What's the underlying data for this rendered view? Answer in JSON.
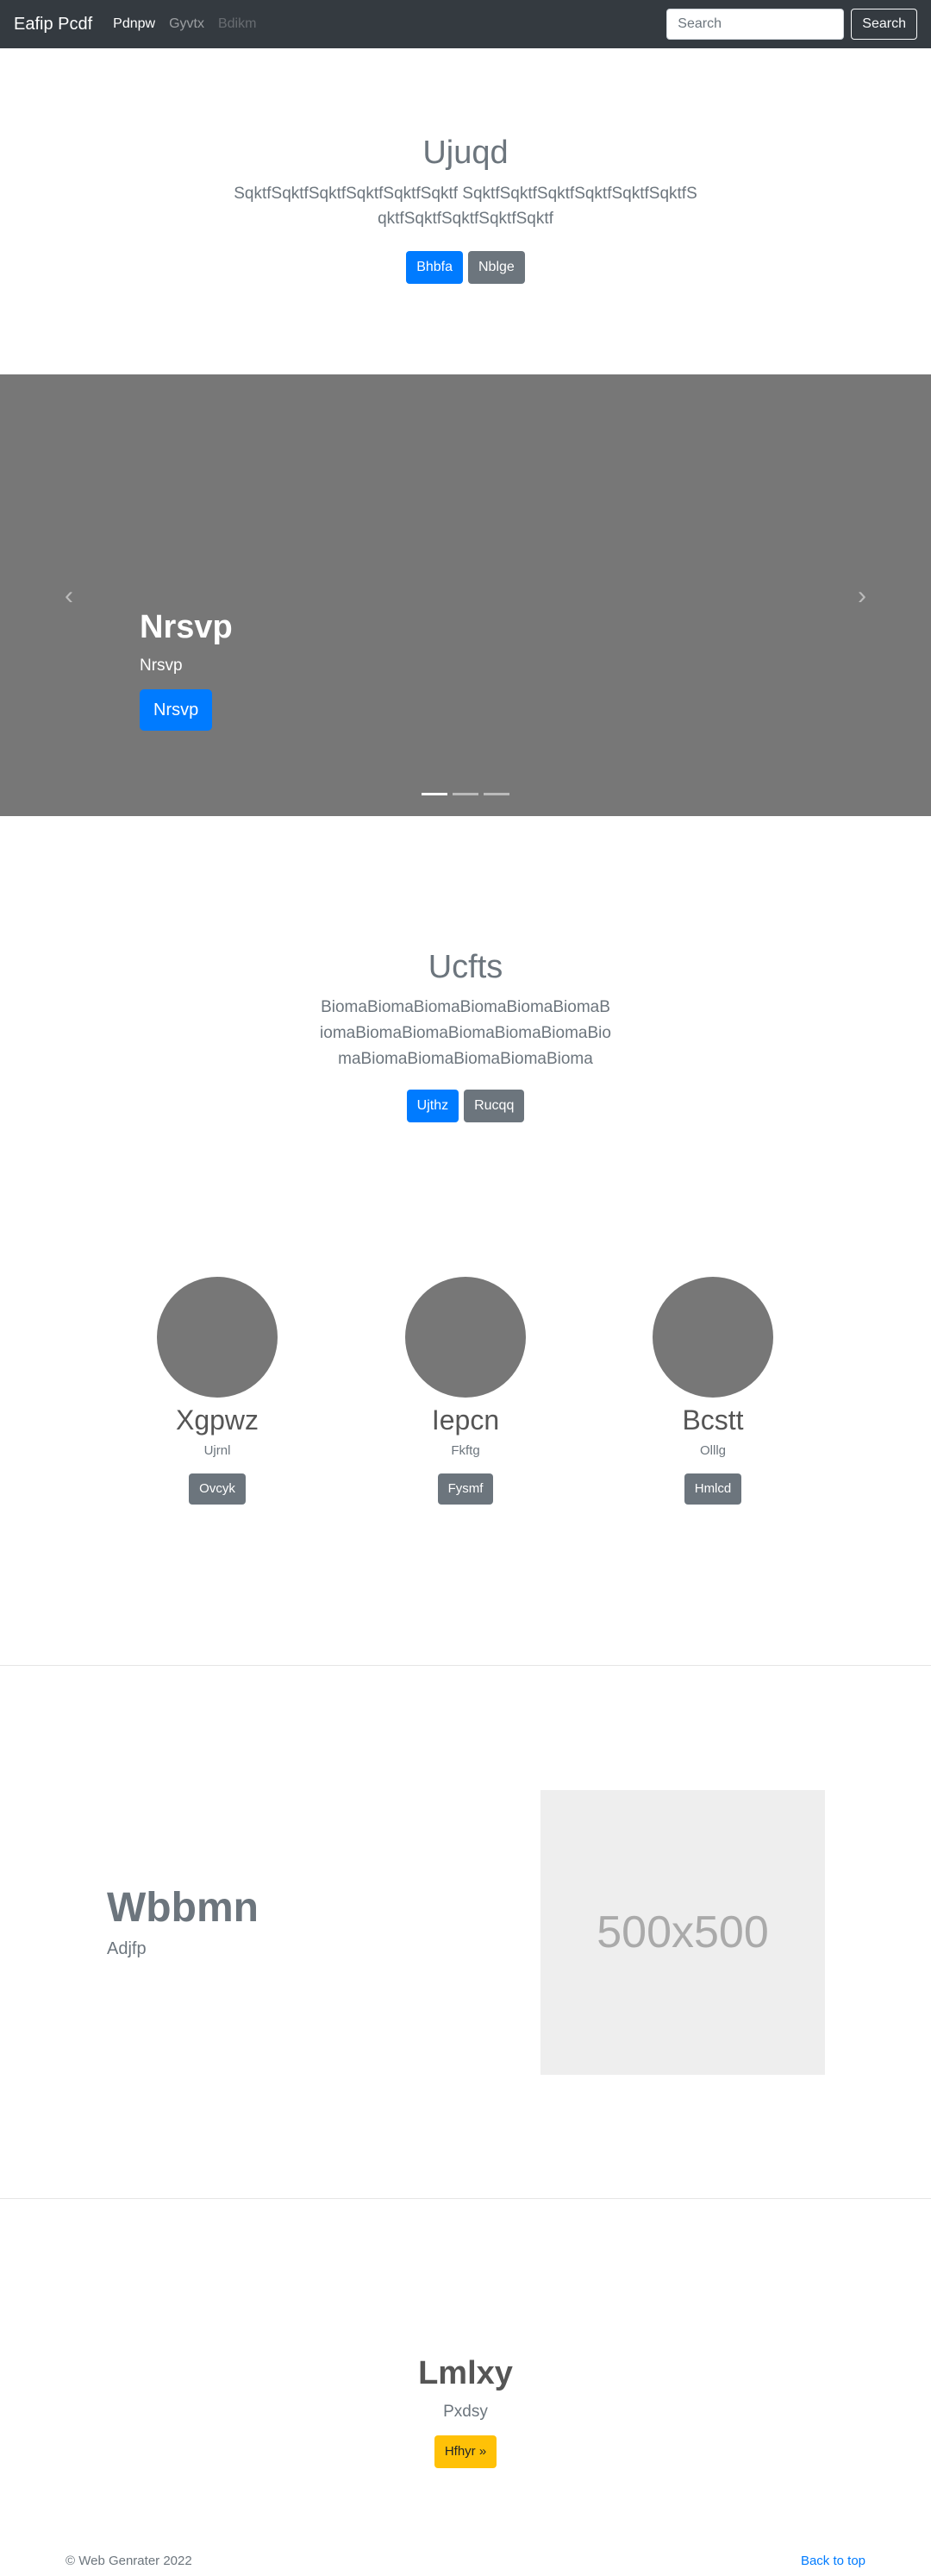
{
  "navbar": {
    "brand": "Eafip Pcdf",
    "links": [
      "Pdnpw",
      "Gyvtx",
      "Bdikm"
    ],
    "search_placeholder": "Search",
    "search_button": "Search"
  },
  "hero": {
    "title": "Ujuqd",
    "text": "SqktfSqktfSqktfSqktfSqktfSqktf SqktfSqktfSqktfSqktfSqktfSqktfSqktfSqktfSqktfSqktfSqktf",
    "primary_button": "Bhbfa",
    "secondary_button": "Nblge"
  },
  "carousel": {
    "title": "Nrsvp",
    "text": "Nrsvp",
    "button": "Nrsvp",
    "prev_icon": "‹",
    "next_icon": "›",
    "slides": 3,
    "active_slide": 1
  },
  "section2": {
    "title": "Ucfts",
    "text": "BiomaBiomaBiomaBiomaBiomaBiomaBiomaBiomaBiomaBiomaBiomaBiomaBiomaBiomaBiomaBiomaBiomaBioma",
    "primary_button": "Ujthz",
    "secondary_button": "Rucqq"
  },
  "columns": [
    {
      "title": "Xgpwz",
      "subtitle": "Ujrnl",
      "button": "Ovcyk"
    },
    {
      "title": "Iepcn",
      "subtitle": "Fkftg",
      "button": "Fysmf"
    },
    {
      "title": "Bcstt",
      "subtitle": "Olllg",
      "button": "Hmlcd"
    }
  ],
  "feature": {
    "title": "Wbbmn",
    "subtitle": "Adjfp",
    "image_label": "500x500"
  },
  "bottom": {
    "title": "Lmlxy",
    "subtitle": "Pxdsy",
    "button": "Hfhyr »"
  },
  "footer": {
    "copyright": "© Web Genrater 2022",
    "back_to_top": "Back to top"
  }
}
